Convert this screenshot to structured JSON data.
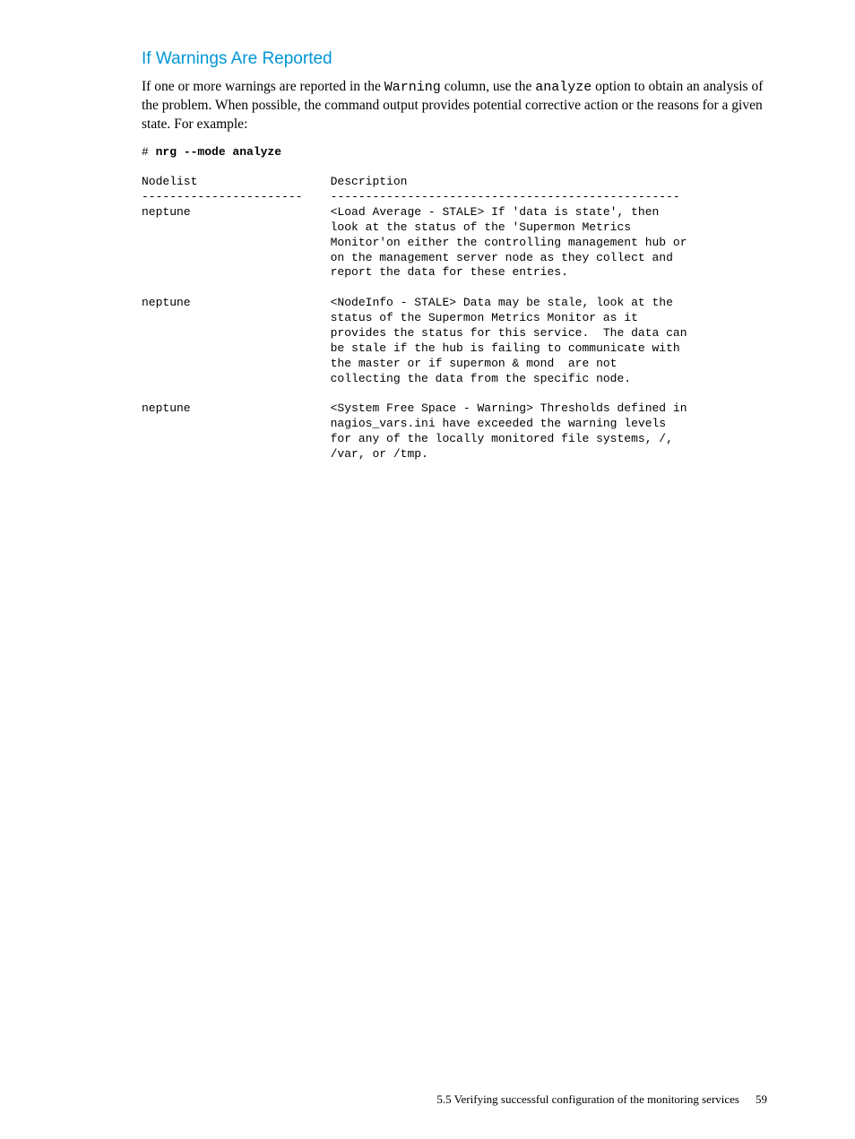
{
  "heading": "If Warnings Are Reported",
  "paragraph": {
    "part1": "If one or more warnings are reported in the ",
    "code1": "Warning",
    "part2": " column, use the ",
    "code2": "analyze",
    "part3": " option to obtain an analysis of the problem. When possible, the command output provides potential corrective action or the reasons for a given state. For example:"
  },
  "command": {
    "prompt": "# ",
    "cmd": "nrg --mode analyze"
  },
  "output": "Nodelist                   Description\n-----------------------    --------------------------------------------------\nneptune                    <Load Average - STALE> If 'data is state', then\n                           look at the status of the 'Supermon Metrics\n                           Monitor'on either the controlling management hub or\n                           on the management server node as they collect and\n                           report the data for these entries.\n\nneptune                    <NodeInfo - STALE> Data may be stale, look at the\n                           status of the Supermon Metrics Monitor as it\n                           provides the status for this service.  The data can\n                           be stale if the hub is failing to communicate with\n                           the master or if supermon & mond  are not\n                           collecting the data from the specific node.\n\nneptune                    <System Free Space - Warning> Thresholds defined in\n                           nagios_vars.ini have exceeded the warning levels\n                           for any of the locally monitored file systems, /,\n                           /var, or /tmp.",
  "footer": {
    "section": "5.5 Verifying successful configuration of the monitoring services",
    "page": "59"
  }
}
